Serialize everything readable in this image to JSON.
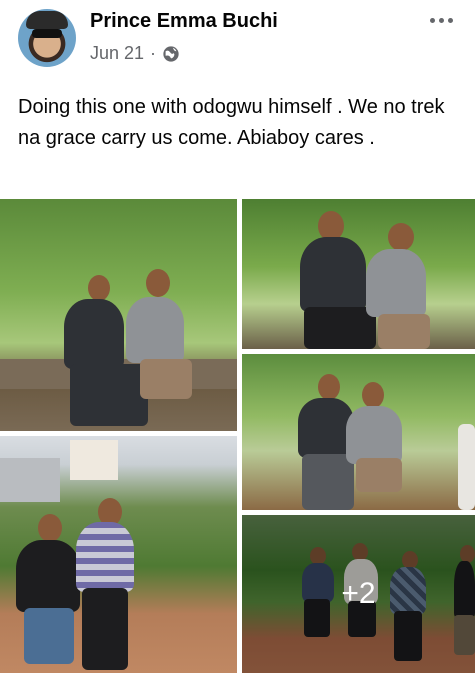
{
  "post": {
    "author": "Prince Emma Buchi",
    "date": "Jun 21",
    "separator": "·",
    "caption": "Doing this one with odogwu himself . We no trek na grace carry us come. Abiaboy cares .",
    "more_photos_count": "+2"
  },
  "icons": {
    "privacy": "globe-icon",
    "menu": "more-options-icon"
  },
  "colors": {
    "text_primary": "#050505",
    "text_secondary": "#65676b",
    "background": "#ffffff"
  }
}
